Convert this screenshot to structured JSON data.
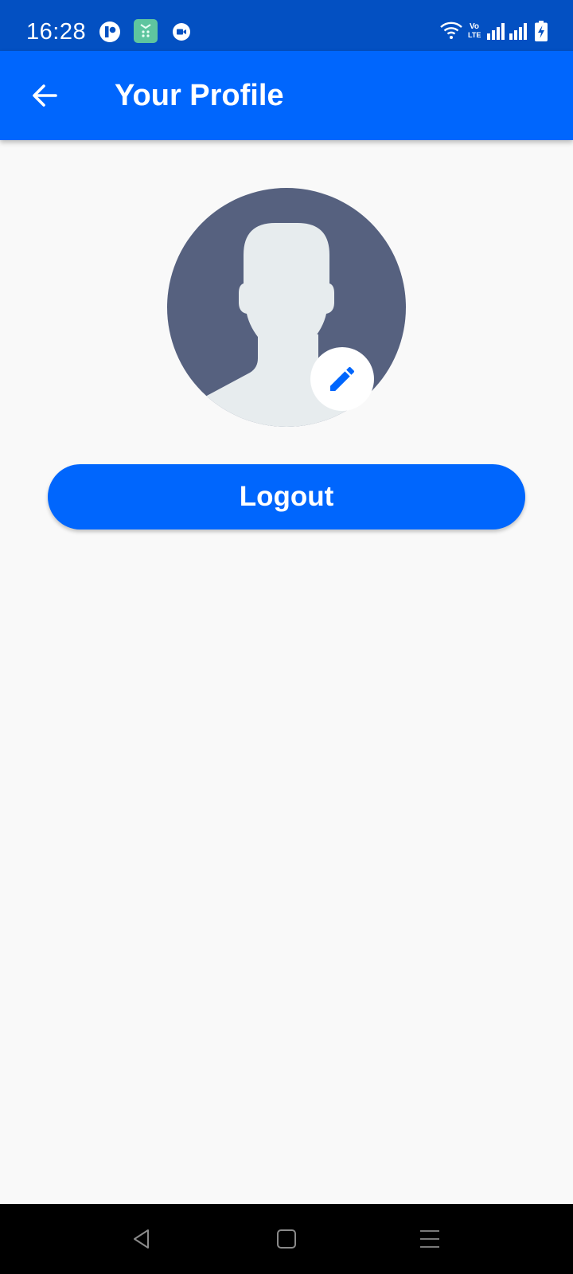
{
  "status_bar": {
    "time": "16:28",
    "notification_icons": [
      "app-r-icon",
      "calculator-app-icon",
      "video-call-icon"
    ],
    "system_icons": [
      "wifi-icon",
      "volte-icon",
      "signal-sim1-icon",
      "signal-sim2-icon",
      "battery-charging-icon"
    ],
    "volte_text_top": "Vo",
    "volte_text_bottom": "LTE",
    "background_color": "#0350c2"
  },
  "app_bar": {
    "title": "Your Profile",
    "back_icon": "arrow-back-icon",
    "background_color": "#0066fd"
  },
  "profile": {
    "avatar": "default-user-silhouette",
    "edit_icon": "pencil-icon"
  },
  "actions": {
    "logout_label": "Logout",
    "accent_color": "#0066fd"
  },
  "nav_bar": {
    "buttons": [
      "back-triangle-icon",
      "home-square-icon",
      "menu-lines-icon"
    ]
  }
}
